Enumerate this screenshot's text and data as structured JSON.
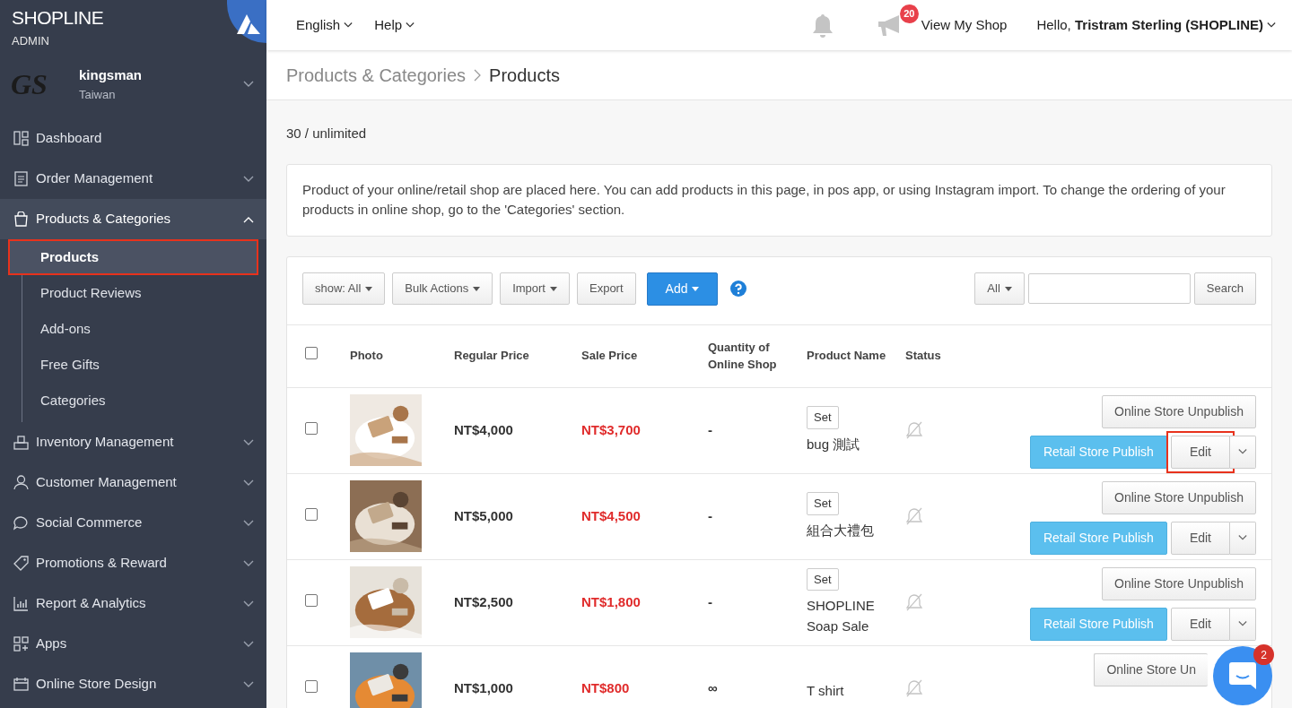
{
  "brand": {
    "name": "**SHOP**LINE",
    "subtitle": "ADMIN"
  },
  "store": {
    "logo_text": "GS",
    "name": "kingsman",
    "region": "Taiwan"
  },
  "topbar": {
    "language": "English",
    "help": "Help",
    "notification_count": "20",
    "view_shop": "View My Shop",
    "greeting": "Hello, **Tristram Sterling (SHOPLINE)**"
  },
  "sidebar": {
    "items": [
      {
        "label": "Dashboard",
        "expandable": false,
        "expanded": false
      },
      {
        "label": "Order Management",
        "expandable": true,
        "expanded": false
      },
      {
        "label": "Products & Categories",
        "expandable": true,
        "expanded": true,
        "children": [
          {
            "label": "Products",
            "selected": true,
            "highlighted": true
          },
          {
            "label": "Product Reviews",
            "selected": false,
            "highlighted": false
          },
          {
            "label": "Add-ons",
            "selected": false,
            "highlighted": false
          },
          {
            "label": "Free Gifts",
            "selected": false,
            "highlighted": false
          },
          {
            "label": "Categories",
            "selected": false,
            "highlighted": false
          }
        ]
      },
      {
        "label": "Inventory Management",
        "expandable": true,
        "expanded": false
      },
      {
        "label": "Customer Management",
        "expandable": true,
        "expanded": false
      },
      {
        "label": "Social Commerce",
        "expandable": true,
        "expanded": false
      },
      {
        "label": "Promotions & Reward",
        "expandable": true,
        "expanded": false
      },
      {
        "label": "Report & Analytics",
        "expandable": true,
        "expanded": false
      },
      {
        "label": "Apps",
        "expandable": true,
        "expanded": false
      },
      {
        "label": "Online Store Design",
        "expandable": true,
        "expanded": false
      }
    ]
  },
  "breadcrumb": [
    "Products & Categories",
    "Products"
  ],
  "quota": "30 / unlimited",
  "info": "Product of your online/retail shop are placed here. You can add products in this page, in pos app, or using Instagram import. To change the ordering of your products in online shop, go to the 'Categories' section.",
  "toolbar": {
    "buttons": [
      {
        "label": "show: All",
        "kind": "dropdown"
      },
      {
        "label": "Bulk Actions",
        "kind": "dropdown"
      },
      {
        "label": "Import",
        "kind": "dropdown"
      },
      {
        "label": "Export",
        "kind": "plain"
      },
      {
        "label": "Add",
        "kind": "primary"
      }
    ],
    "filter": "All",
    "search_button": "Search"
  },
  "table": {
    "select_all_checked": false,
    "columns": [
      "Photo",
      "Regular Price",
      "Sale Price",
      "Quantity of Online Shop",
      "Product Name",
      "Status"
    ],
    "rows": [
      {
        "checked": false,
        "regular_price": "NT$4,000",
        "sale_price": "NT$3,700",
        "quantity": "-",
        "tag": "Set",
        "name": "bug 測試",
        "unpublish": "Online Store Unpublish",
        "publish": "Retail Store Publish",
        "edit": "Edit",
        "edit_highlighted": true
      },
      {
        "checked": false,
        "regular_price": "NT$5,000",
        "sale_price": "NT$4,500",
        "quantity": "-",
        "tag": "Set",
        "name": "組合大禮包",
        "unpublish": "Online Store Unpublish",
        "publish": "Retail Store Publish",
        "edit": "Edit",
        "edit_highlighted": false
      },
      {
        "checked": false,
        "regular_price": "NT$2,500",
        "sale_price": "NT$1,800",
        "quantity": "-",
        "tag": "Set",
        "name": "SHOPLINE Soap Sale",
        "unpublish": "Online Store Unpublish",
        "publish": "Retail Store Publish",
        "edit": "Edit",
        "edit_highlighted": false
      },
      {
        "checked": false,
        "regular_price": "NT$1,000",
        "sale_price": "NT$800",
        "quantity": "∞",
        "name": "T shirt",
        "unpublish": "Online Store Un"
      }
    ]
  },
  "chat": {
    "badge": "2"
  }
}
